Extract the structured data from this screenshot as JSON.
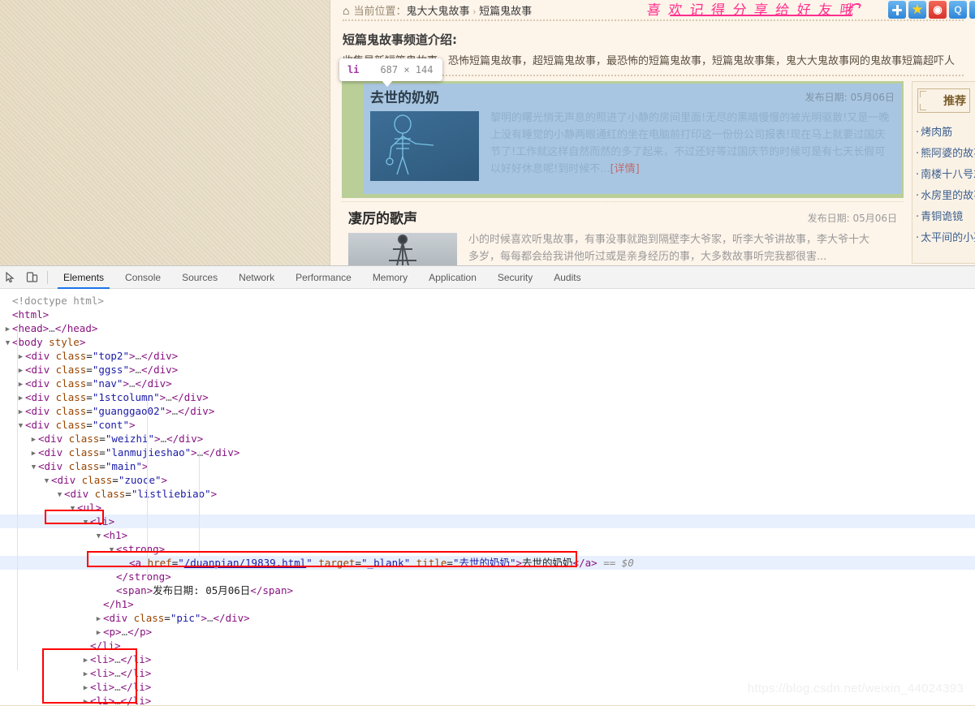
{
  "page": {
    "breadcrumb": {
      "home_icon": "home-icon",
      "label": "当前位置：",
      "link": "鬼大大鬼故事",
      "separator": "›",
      "current": "短篇鬼故事"
    },
    "channel_intro_title": "短篇鬼故事频道介绍:",
    "channel_intro_text": "收集最新短篇鬼故事，恐怖短篇鬼故事，超短篇鬼故事，最恐怖的短篇鬼故事，短篇鬼故事集，鬼大大鬼故事网的鬼故事短篇超吓人",
    "share_text": "喜 欢 记 得 分 享 给 好 友 哦",
    "share_icons": [
      "plus-icon",
      "star-icon",
      "weibo-icon",
      "qzone-icon"
    ],
    "articles": [
      {
        "title": "去世的奶奶",
        "date_label": "发布日期:",
        "date": "05月06日",
        "body": "黎明的曙光悄无声息的照进了小静的房间里面!无尽的黑暗慢慢的被光明驱散!又是一晚上没有睡觉的小静两眼通红的坐在电脑前打印这一份份公司报表!现在马上就要过国庆节了!工作就这样自然而然的多了起来，不过还好等过国庆节的时候可是有七天长假可以好好休息呢!到时候不...",
        "more": "[详情]",
        "thumb": "skeleton-thumbnail"
      },
      {
        "title": "凄厉的歌声",
        "date_label": "发布日期:",
        "date": "05月06日",
        "body": "小的时候喜欢听鬼故事，有事没事就跑到隔壁李大爷家，听李大爷讲故事，李大爷十大多岁，每每都会给我讲他听过或是亲身经历的事，大多数故事听完我都很害...",
        "thumb": "tower-thumbnail"
      }
    ],
    "sidebar": {
      "heading": "推荐",
      "items": [
        "烤肉筋",
        "熊阿婆的故事",
        "南楼十八号左",
        "水房里的故事",
        "青铜诡镜",
        "太平间的小孩"
      ]
    }
  },
  "inspector_tooltip": {
    "tag": "li",
    "dimensions": "687 × 144"
  },
  "devtools": {
    "inspect_icon": "inspect-cursor-icon",
    "device_icon": "device-toolbar-icon",
    "tabs": [
      {
        "label": "Elements",
        "active": true
      },
      {
        "label": "Console",
        "active": false
      },
      {
        "label": "Sources",
        "active": false
      },
      {
        "label": "Network",
        "active": false
      },
      {
        "label": "Performance",
        "active": false
      },
      {
        "label": "Memory",
        "active": false
      },
      {
        "label": "Application",
        "active": false
      },
      {
        "label": "Security",
        "active": false
      },
      {
        "label": "Audits",
        "active": false
      }
    ],
    "dom_lines": [
      {
        "indent": 0,
        "twisty": "none",
        "html": "<span class='doct'>&lt;!doctype html&gt;</span>"
      },
      {
        "indent": 0,
        "twisty": "none",
        "html": "<span class='p'>&lt;html&gt;</span>"
      },
      {
        "indent": 0,
        "twisty": "right",
        "html": "<span class='p'>&lt;head&gt;</span><span class='ell'>…</span><span class='p'>&lt;/head&gt;</span>"
      },
      {
        "indent": 0,
        "twisty": "down",
        "html": "<span class='p'>&lt;body</span> <span class='an'>style</span><span class='p'>&gt;</span>"
      },
      {
        "indent": 1,
        "twisty": "right",
        "html": "<span class='p'>&lt;div</span> <span class='an'>class</span>=<span class='av'>\"top2\"</span><span class='p'>&gt;</span><span class='ell'>…</span><span class='p'>&lt;/div&gt;</span>"
      },
      {
        "indent": 1,
        "twisty": "right",
        "html": "<span class='p'>&lt;div</span> <span class='an'>class</span>=<span class='av'>\"ggss\"</span><span class='p'>&gt;</span><span class='ell'>…</span><span class='p'>&lt;/div&gt;</span>"
      },
      {
        "indent": 1,
        "twisty": "right",
        "html": "<span class='p'>&lt;div</span> <span class='an'>class</span>=<span class='av'>\"nav\"</span><span class='p'>&gt;</span><span class='ell'>…</span><span class='p'>&lt;/div&gt;</span>"
      },
      {
        "indent": 1,
        "twisty": "right",
        "html": "<span class='p'>&lt;div</span> <span class='an'>class</span>=<span class='av'>\"1stcolumn\"</span><span class='p'>&gt;</span><span class='ell'>…</span><span class='p'>&lt;/div&gt;</span>"
      },
      {
        "indent": 1,
        "twisty": "right",
        "html": "<span class='p'>&lt;div</span> <span class='an'>class</span>=<span class='av'>\"guanggao02\"</span><span class='p'>&gt;</span><span class='ell'>…</span><span class='p'>&lt;/div&gt;</span>"
      },
      {
        "indent": 1,
        "twisty": "down",
        "html": "<span class='p'>&lt;div</span> <span class='an'>class</span>=<span class='av'>\"cont\"</span><span class='p'>&gt;</span>"
      },
      {
        "indent": 2,
        "twisty": "right",
        "html": "<span class='p'>&lt;div</span> <span class='an'>class</span>=<span class='av'>\"weizhi\"</span><span class='p'>&gt;</span><span class='ell'>…</span><span class='p'>&lt;/div&gt;</span>"
      },
      {
        "indent": 2,
        "twisty": "right",
        "html": "<span class='p'>&lt;div</span> <span class='an'>class</span>=<span class='av'>\"lanmujieshao\"</span><span class='p'>&gt;</span><span class='ell'>…</span><span class='p'>&lt;/div&gt;</span>"
      },
      {
        "indent": 2,
        "twisty": "down",
        "html": "<span class='p'>&lt;div</span> <span class='an'>class</span>=<span class='av'>\"main\"</span><span class='p'>&gt;</span>"
      },
      {
        "indent": 3,
        "twisty": "down",
        "html": "<span class='p'>&lt;div</span> <span class='an'>class</span>=<span class='av'>\"zuoce\"</span><span class='p'>&gt;</span>"
      },
      {
        "indent": 4,
        "twisty": "down",
        "html": "<span class='p'>&lt;div</span> <span class='an'>class</span>=<span class='av'>\"listliebiao\"</span><span class='p'>&gt;</span>"
      },
      {
        "indent": 5,
        "twisty": "down",
        "html": "<span class='p'>&lt;ul&gt;</span>"
      },
      {
        "indent": 6,
        "twisty": "down",
        "selected": true,
        "html": "<span class='p'>&lt;li&gt;</span>"
      },
      {
        "indent": 7,
        "twisty": "down",
        "html": "<span class='p'>&lt;h1&gt;</span>"
      },
      {
        "indent": 8,
        "twisty": "down",
        "html": "<span class='p'>&lt;strong&gt;</span>"
      },
      {
        "indent": 9,
        "twisty": "none",
        "selected": true,
        "html": "<span class='p'>&lt;a</span> <span class='an'>href</span>=<span class='av'>\"</span><span class='lk'>/duanpian/19839.html</span><span class='av'>\"</span> <span class='an'>target</span>=<span class='av'>\"_blank\"</span> <span class='an'>title</span>=<span class='av'>\"去世的奶奶\"</span><span class='p'>&gt;</span><span class='txt'>去世的奶奶</span><span class='p'>&lt;/a&gt;</span> <span class='dollar'>== $0</span>"
      },
      {
        "indent": 8,
        "twisty": "none",
        "html": "<span class='p'>&lt;/strong&gt;</span>"
      },
      {
        "indent": 8,
        "twisty": "none",
        "html": "<span class='p'>&lt;span&gt;</span><span class='txt'>发布日期: 05月06日</span><span class='p'>&lt;/span&gt;</span>"
      },
      {
        "indent": 7,
        "twisty": "none",
        "html": "<span class='p'>&lt;/h1&gt;</span>"
      },
      {
        "indent": 7,
        "twisty": "right",
        "html": "<span class='p'>&lt;div</span> <span class='an'>class</span>=<span class='av'>\"pic\"</span><span class='p'>&gt;</span><span class='ell'>…</span><span class='p'>&lt;/div&gt;</span>"
      },
      {
        "indent": 7,
        "twisty": "right",
        "html": "<span class='p'>&lt;p&gt;</span><span class='ell'>…</span><span class='p'>&lt;/p&gt;</span>"
      },
      {
        "indent": 6,
        "twisty": "none",
        "html": "<span class='p'>&lt;/li&gt;</span>"
      },
      {
        "indent": 6,
        "twisty": "right",
        "html": "<span class='p'>&lt;li&gt;</span><span class='ell'>…</span><span class='p'>&lt;/li&gt;</span>"
      },
      {
        "indent": 6,
        "twisty": "right",
        "html": "<span class='p'>&lt;li&gt;</span><span class='ell'>…</span><span class='p'>&lt;/li&gt;</span>"
      },
      {
        "indent": 6,
        "twisty": "right",
        "html": "<span class='p'>&lt;li&gt;</span><span class='ell'>…</span><span class='p'>&lt;/li&gt;</span>"
      },
      {
        "indent": 6,
        "twisty": "right",
        "html": "<span class='p'>&lt;li&gt;</span><span class='ell'>…</span><span class='p'>&lt;/li&gt;</span>"
      }
    ]
  },
  "watermark": "https://blog.csdn.net/weixin_44024393"
}
